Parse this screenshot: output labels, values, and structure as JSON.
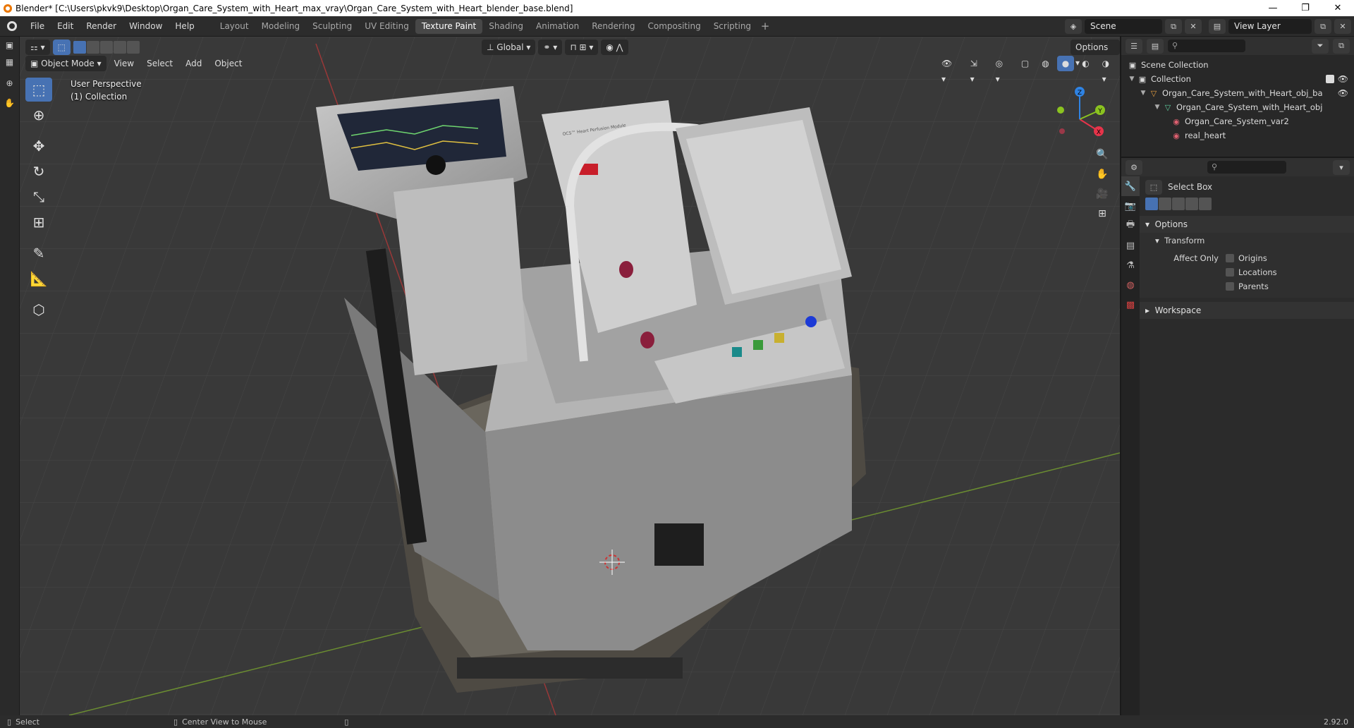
{
  "window": {
    "title": "Blender* [C:\\Users\\pkvk9\\Desktop\\Organ_Care_System_with_Heart_max_vray\\Organ_Care_System_with_Heart_blender_base.blend]",
    "controls": {
      "minimize": "—",
      "maximize": "❐",
      "close": "✕"
    }
  },
  "menubar": {
    "items": [
      "File",
      "Edit",
      "Render",
      "Window",
      "Help"
    ]
  },
  "workspaces": {
    "tabs": [
      "Layout",
      "Modeling",
      "Sculpting",
      "UV Editing",
      "Texture Paint",
      "Shading",
      "Animation",
      "Rendering",
      "Compositing",
      "Scripting"
    ],
    "active": "Texture Paint",
    "add": "+"
  },
  "scene": {
    "name": "Scene",
    "view_layer": "View Layer"
  },
  "viewport": {
    "mode": "Object Mode",
    "menus": [
      "View",
      "Select",
      "Add",
      "Object"
    ],
    "transform_orientation": "Global",
    "options_label": "Options",
    "overlay_lines": [
      "User Perspective",
      "(1) Collection"
    ],
    "gizmo": {
      "x": "X",
      "y": "Y",
      "z": "Z",
      "x_color": "#e6344a",
      "y_color": "#8bc320",
      "z_color": "#2f83e3"
    }
  },
  "tools": [
    "select-box",
    "cursor",
    "move",
    "rotate",
    "scale",
    "transform",
    "annotate",
    "measure",
    "add-cube"
  ],
  "outliner": {
    "search_placeholder": "",
    "rows": [
      {
        "label": "Scene Collection",
        "indent": 0,
        "icon": "scene-collection-icon"
      },
      {
        "label": "Collection",
        "indent": 1,
        "icon": "collection-icon"
      },
      {
        "label": "Organ_Care_System_with_Heart_obj_ba",
        "indent": 2,
        "icon": "object-icon"
      },
      {
        "label": "Organ_Care_System_with_Heart_obj",
        "indent": 3,
        "icon": "mesh-icon"
      },
      {
        "label": "Organ_Care_System_var2",
        "indent": 4,
        "icon": "material-icon"
      },
      {
        "label": "real_heart",
        "indent": 4,
        "icon": "material-icon"
      }
    ]
  },
  "properties": {
    "tool_name": "Select Box",
    "options_header": "Options",
    "transform_header": "Transform",
    "affect_only_label": "Affect Only",
    "checkboxes": [
      "Origins",
      "Locations",
      "Parents"
    ],
    "workspace_header": "Workspace"
  },
  "statusbar": {
    "left": "Select",
    "middle": "Center View to Mouse",
    "version": "2.92.0"
  },
  "colors": {
    "accent": "#4772b3",
    "background": "#393939",
    "panel": "#2b2b2b"
  }
}
